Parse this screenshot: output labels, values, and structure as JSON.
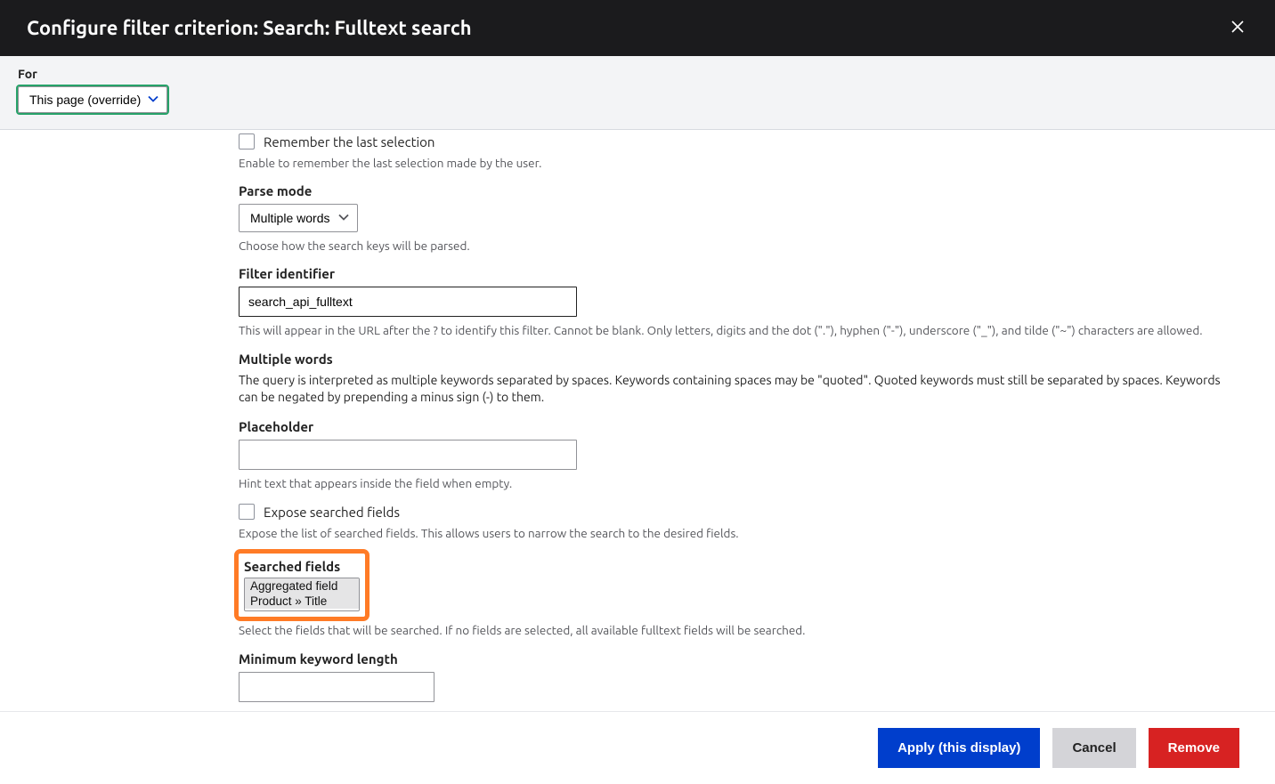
{
  "header": {
    "title": "Configure filter criterion: Search: Fulltext search"
  },
  "forBar": {
    "label": "For",
    "selected": "This page (override)"
  },
  "form": {
    "remember": {
      "label": "Remember the last selection",
      "desc": "Enable to remember the last selection made by the user."
    },
    "parseMode": {
      "label": "Parse mode",
      "selected": "Multiple words",
      "desc": "Choose how the search keys will be parsed."
    },
    "filterId": {
      "label": "Filter identifier",
      "value": "search_api_fulltext",
      "desc": "This will appear in the URL after the ? to identify this filter. Cannot be blank. Only letters, digits and the dot (\".\"), hyphen (\"-\"), underscore (\"_\"), and tilde (\"~\") characters are allowed."
    },
    "multipleWords": {
      "label": "Multiple words",
      "body": "The query is interpreted as multiple keywords separated by spaces. Keywords containing spaces may be \"quoted\". Quoted keywords must still be separated by spaces. Keywords can be negated by prepending a minus sign (-) to them."
    },
    "placeholder": {
      "label": "Placeholder",
      "value": "",
      "desc": "Hint text that appears inside the field when empty."
    },
    "exposeFields": {
      "label": "Expose searched fields",
      "desc": "Expose the list of searched fields. This allows users to narrow the search to the desired fields."
    },
    "searchedFields": {
      "label": "Searched fields",
      "options": [
        "Aggregated field",
        "Product » Title"
      ],
      "desc": "Select the fields that will be searched. If no fields are selected, all available fulltext fields will be searched."
    },
    "minKeyword": {
      "label": "Minimum keyword length",
      "value": ""
    }
  },
  "footer": {
    "apply": "Apply (this display)",
    "cancel": "Cancel",
    "remove": "Remove"
  }
}
